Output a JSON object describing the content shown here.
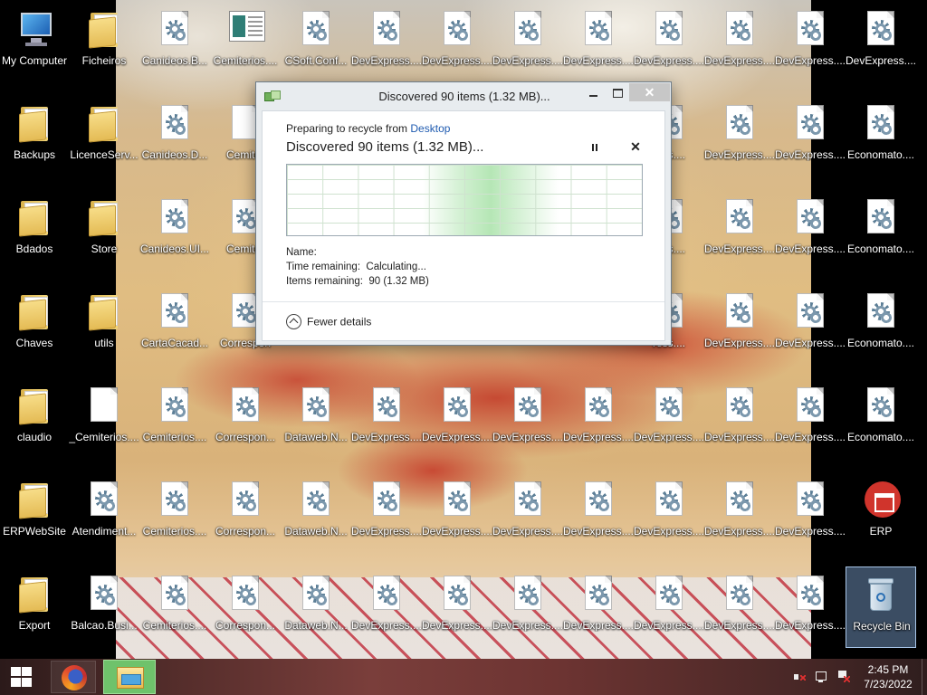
{
  "desktop": {
    "icons": [
      {
        "label": "My Computer",
        "type": "computer",
        "col": 0,
        "row": 0
      },
      {
        "label": "Ficheiros",
        "type": "folder",
        "col": 1,
        "row": 0
      },
      {
        "label": "Canideos.B...",
        "type": "doc",
        "col": 2,
        "row": 0
      },
      {
        "label": "Cemiterios....",
        "type": "app",
        "col": 3,
        "row": 0
      },
      {
        "label": "CSoft.Conf...",
        "type": "doc",
        "col": 4,
        "row": 0
      },
      {
        "label": "DevExpress....",
        "type": "doc",
        "col": 5,
        "row": 0
      },
      {
        "label": "DevExpress....",
        "type": "doc",
        "col": 6,
        "row": 0
      },
      {
        "label": "DevExpress....",
        "type": "doc",
        "col": 7,
        "row": 0
      },
      {
        "label": "DevExpress....",
        "type": "doc",
        "col": 8,
        "row": 0
      },
      {
        "label": "DevExpress....",
        "type": "doc",
        "col": 9,
        "row": 0
      },
      {
        "label": "DevExpress....",
        "type": "doc",
        "col": 10,
        "row": 0
      },
      {
        "label": "DevExpress....",
        "type": "doc",
        "col": 11,
        "row": 0
      },
      {
        "label": "DevExpress....",
        "type": "doc",
        "col": 12,
        "row": 0
      },
      {
        "label": "Backups",
        "type": "folder",
        "col": 0,
        "row": 1
      },
      {
        "label": "LicenceServ...",
        "type": "folder",
        "col": 1,
        "row": 1
      },
      {
        "label": "Canideos.D...",
        "type": "doc",
        "col": 2,
        "row": 1
      },
      {
        "label": "Cemiter",
        "type": "blank",
        "col": 3,
        "row": 1
      },
      {
        "label": "ress....",
        "type": "doc",
        "col": 9,
        "row": 1
      },
      {
        "label": "DevExpress....",
        "type": "doc",
        "col": 10,
        "row": 1
      },
      {
        "label": "DevExpress....",
        "type": "doc",
        "col": 11,
        "row": 1
      },
      {
        "label": "Economato....",
        "type": "doc",
        "col": 12,
        "row": 1
      },
      {
        "label": "Bdados",
        "type": "folder",
        "col": 0,
        "row": 2
      },
      {
        "label": "Store",
        "type": "folder",
        "col": 1,
        "row": 2
      },
      {
        "label": "Canideos.UI...",
        "type": "doc",
        "col": 2,
        "row": 2
      },
      {
        "label": "Cemiter",
        "type": "doc",
        "col": 3,
        "row": 2
      },
      {
        "label": "ress....",
        "type": "doc",
        "col": 9,
        "row": 2
      },
      {
        "label": "DevExpress....",
        "type": "doc",
        "col": 10,
        "row": 2
      },
      {
        "label": "DevExpress....",
        "type": "doc",
        "col": 11,
        "row": 2
      },
      {
        "label": "Economato....",
        "type": "doc",
        "col": 12,
        "row": 2
      },
      {
        "label": "Chaves",
        "type": "folder",
        "col": 0,
        "row": 3
      },
      {
        "label": "utils",
        "type": "folder",
        "col": 1,
        "row": 3
      },
      {
        "label": "CartaCacad...",
        "type": "doc",
        "col": 2,
        "row": 3
      },
      {
        "label": "Correspon",
        "type": "doc",
        "col": 3,
        "row": 3
      },
      {
        "label": "ress....",
        "type": "doc",
        "col": 9,
        "row": 3
      },
      {
        "label": "DevExpress....",
        "type": "doc",
        "col": 10,
        "row": 3
      },
      {
        "label": "DevExpress....",
        "type": "doc",
        "col": 11,
        "row": 3
      },
      {
        "label": "Economato....",
        "type": "doc",
        "col": 12,
        "row": 3
      },
      {
        "label": "claudio",
        "type": "folder",
        "col": 0,
        "row": 4
      },
      {
        "label": "_Cemiterios....",
        "type": "blank",
        "col": 1,
        "row": 4
      },
      {
        "label": "Cemiterios....",
        "type": "doc",
        "col": 2,
        "row": 4
      },
      {
        "label": "Correspon...",
        "type": "doc",
        "col": 3,
        "row": 4
      },
      {
        "label": "Dataweb.N...",
        "type": "doc",
        "col": 4,
        "row": 4
      },
      {
        "label": "DevExpress....",
        "type": "doc",
        "col": 5,
        "row": 4
      },
      {
        "label": "DevExpress....",
        "type": "doc",
        "col": 6,
        "row": 4
      },
      {
        "label": "DevExpress....",
        "type": "doc",
        "col": 7,
        "row": 4
      },
      {
        "label": "DevExpress....",
        "type": "doc",
        "col": 8,
        "row": 4
      },
      {
        "label": "DevExpress....",
        "type": "doc",
        "col": 9,
        "row": 4
      },
      {
        "label": "DevExpress....",
        "type": "doc",
        "col": 10,
        "row": 4
      },
      {
        "label": "DevExpress....",
        "type": "doc",
        "col": 11,
        "row": 4
      },
      {
        "label": "Economato....",
        "type": "doc",
        "col": 12,
        "row": 4
      },
      {
        "label": "ERPWebSite",
        "type": "folder",
        "col": 0,
        "row": 5
      },
      {
        "label": "Atendiment...",
        "type": "doc",
        "col": 1,
        "row": 5
      },
      {
        "label": "Cemiterios....",
        "type": "doc",
        "col": 2,
        "row": 5
      },
      {
        "label": "Correspon...",
        "type": "doc",
        "col": 3,
        "row": 5
      },
      {
        "label": "Dataweb.N...",
        "type": "doc",
        "col": 4,
        "row": 5
      },
      {
        "label": "DevExpress....",
        "type": "doc",
        "col": 5,
        "row": 5
      },
      {
        "label": "DevExpress....",
        "type": "doc",
        "col": 6,
        "row": 5
      },
      {
        "label": "DevExpress....",
        "type": "doc",
        "col": 7,
        "row": 5
      },
      {
        "label": "DevExpress....",
        "type": "doc",
        "col": 8,
        "row": 5
      },
      {
        "label": "DevExpress....",
        "type": "doc",
        "col": 9,
        "row": 5
      },
      {
        "label": "DevExpress....",
        "type": "doc",
        "col": 10,
        "row": 5
      },
      {
        "label": "DevExpress....",
        "type": "doc",
        "col": 11,
        "row": 5
      },
      {
        "label": "ERP",
        "type": "erp",
        "col": 12,
        "row": 5
      },
      {
        "label": "Export",
        "type": "folder",
        "col": 0,
        "row": 6
      },
      {
        "label": "Balcao.Busi...",
        "type": "doc",
        "col": 1,
        "row": 6
      },
      {
        "label": "Cemiterios....",
        "type": "doc",
        "col": 2,
        "row": 6
      },
      {
        "label": "Correspon...",
        "type": "doc",
        "col": 3,
        "row": 6
      },
      {
        "label": "Dataweb.N...",
        "type": "doc",
        "col": 4,
        "row": 6
      },
      {
        "label": "DevExpress....",
        "type": "doc",
        "col": 5,
        "row": 6
      },
      {
        "label": "DevExpress....",
        "type": "doc",
        "col": 6,
        "row": 6
      },
      {
        "label": "DevExpress....",
        "type": "doc",
        "col": 7,
        "row": 6
      },
      {
        "label": "DevExpress....",
        "type": "doc",
        "col": 8,
        "row": 6
      },
      {
        "label": "DevExpress....",
        "type": "doc",
        "col": 9,
        "row": 6
      },
      {
        "label": "DevExpress....",
        "type": "doc",
        "col": 10,
        "row": 6
      },
      {
        "label": "DevExpress....",
        "type": "doc",
        "col": 11,
        "row": 6
      },
      {
        "label": "Recycle Bin",
        "type": "bin",
        "col": 12,
        "row": 6,
        "selected": true
      }
    ]
  },
  "dialog": {
    "title": "Discovered 90 items (1.32 MB)...",
    "preparing_prefix": "Preparing to recycle from ",
    "preparing_location": "Desktop",
    "status": "Discovered 90 items (1.32 MB)...",
    "name_label": "Name:",
    "name_value": "",
    "time_label": "Time remaining:",
    "time_value": "Calculating...",
    "items_label": "Items remaining:",
    "items_value": "90 (1.32 MB)",
    "fewer_details": "Fewer details",
    "close_glyph": "✕",
    "cancel_glyph": "✕",
    "graph_color": "#a8e2a8"
  },
  "taskbar": {
    "pinned": [
      "Firefox",
      "File Explorer"
    ],
    "clock_time": "2:45 PM",
    "clock_date": "7/23/2022",
    "tray_icons": [
      "volume-muted-icon",
      "network-icon",
      "action-center-flag-icon"
    ]
  }
}
